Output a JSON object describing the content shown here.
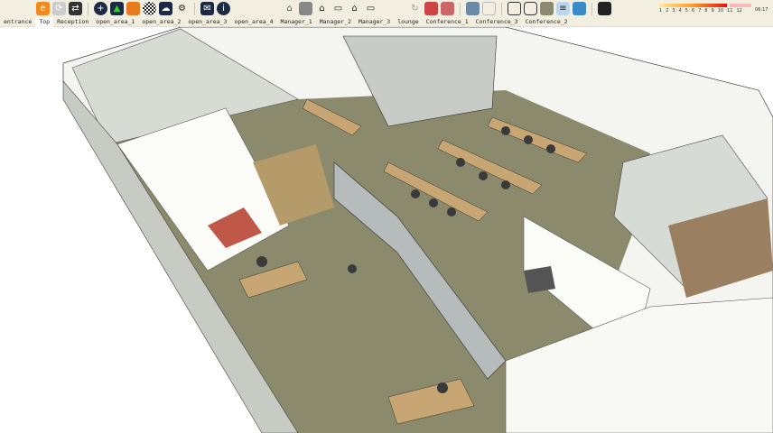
{
  "toolbar": {
    "icons": [
      "extension-warehouse-icon",
      "reload-icon",
      "layer-swap-icon",
      "add-icon",
      "tree-icon",
      "terrain-icon",
      "sphere-icon",
      "cloud-upload-icon",
      "settings-icon",
      "mail-icon",
      "info-icon",
      "house-icon",
      "door-icon",
      "home-icon",
      "box-open-icon",
      "house-outline-icon",
      "box-icon",
      "rotate-icon",
      "render-icon",
      "render-go-icon",
      "section-icon",
      "section-outline-icon",
      "cube-wire-icon",
      "cube-outline-icon",
      "cube-shaded-icon",
      "cube-textured-icon",
      "cube-blue-icon",
      "shadow-toggle-icon"
    ]
  },
  "scenes": {
    "tabs": [
      "entrance",
      "Top",
      "Reception",
      "open_area_1",
      "open_area_2",
      "open_area_3",
      "open_area_4",
      "Manager_1",
      "Manager_2",
      "Manager_3",
      "lounge",
      "Conference_1",
      "Conference_3",
      "Conference_2"
    ],
    "active": "Top"
  },
  "shadow": {
    "months": [
      "1",
      "2",
      "3",
      "4",
      "5",
      "6",
      "7",
      "8",
      "9",
      "10",
      "11",
      "12"
    ],
    "time": "06:17"
  }
}
